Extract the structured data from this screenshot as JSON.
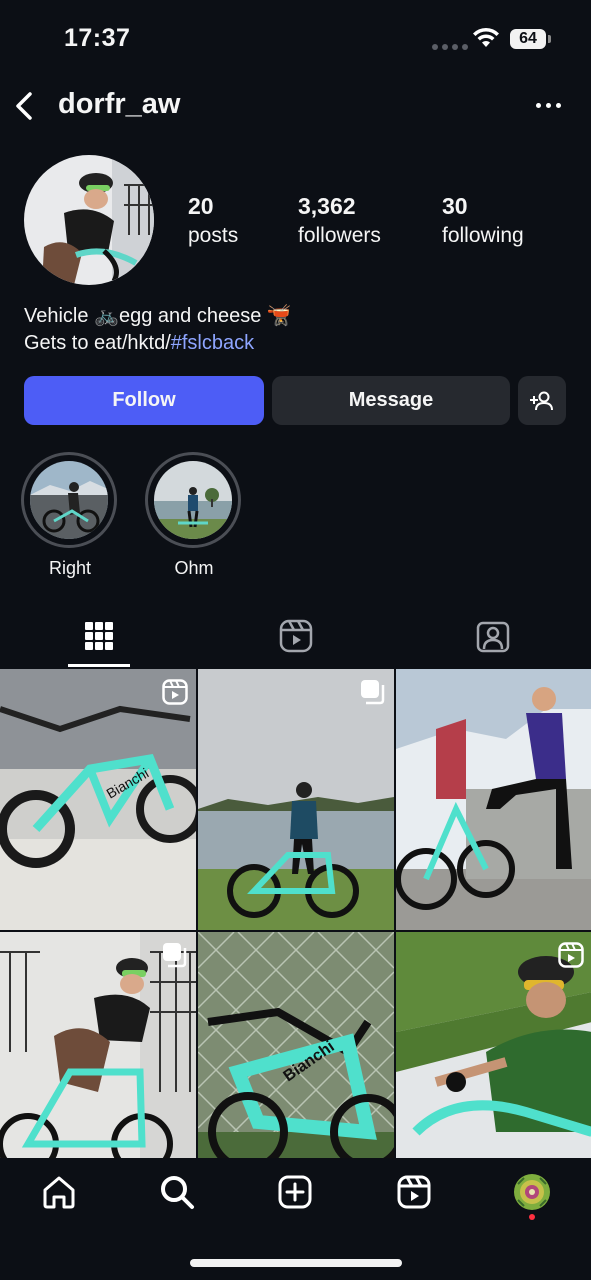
{
  "status_bar": {
    "time": "17:37",
    "battery": "64",
    "icons": [
      "signal-dots-icon",
      "wifi-icon",
      "battery-icon"
    ]
  },
  "header": {
    "username": "dorfr_aw",
    "back_icon": "chevron-left-icon",
    "more_icon": "more-horizontal-icon"
  },
  "profile": {
    "stats": [
      {
        "value": "20",
        "label": "posts"
      },
      {
        "value": "3,362",
        "label": "followers"
      },
      {
        "value": "30",
        "label": "following"
      }
    ],
    "bio_line1_a": "Vehicle ",
    "bio_emoji_bike": "🚲",
    "bio_line1_b": "egg and cheese ",
    "bio_emoji_food": "🫕",
    "bio_line2_text": "Gets to eat/hktd/",
    "bio_hashtag": "#fslcback"
  },
  "actions": {
    "follow": "Follow",
    "message": "Message",
    "add_user_icon": "add-user-icon"
  },
  "highlights": [
    {
      "label": "Right"
    },
    {
      "label": "Ohm"
    }
  ],
  "tabs": [
    {
      "icon": "grid-icon",
      "active": true
    },
    {
      "icon": "reels-icon",
      "active": false
    },
    {
      "icon": "tagged-icon",
      "active": false
    }
  ],
  "posts": [
    {
      "badge": "reel-icon"
    },
    {
      "badge": "carousel-icon"
    },
    {
      "badge": ""
    },
    {
      "badge": "carousel-icon"
    },
    {
      "badge": ""
    },
    {
      "badge": "reel-icon"
    }
  ],
  "bottom_nav": [
    "home-icon",
    "search-icon",
    "create-icon",
    "reels-icon",
    "profile-icon"
  ],
  "colors": {
    "background": "#0c0f15",
    "follow_button": "#4d5df6",
    "secondary_button": "#26292f",
    "hashtag": "#8ea5ff",
    "notification_dot": "#ff3040"
  }
}
